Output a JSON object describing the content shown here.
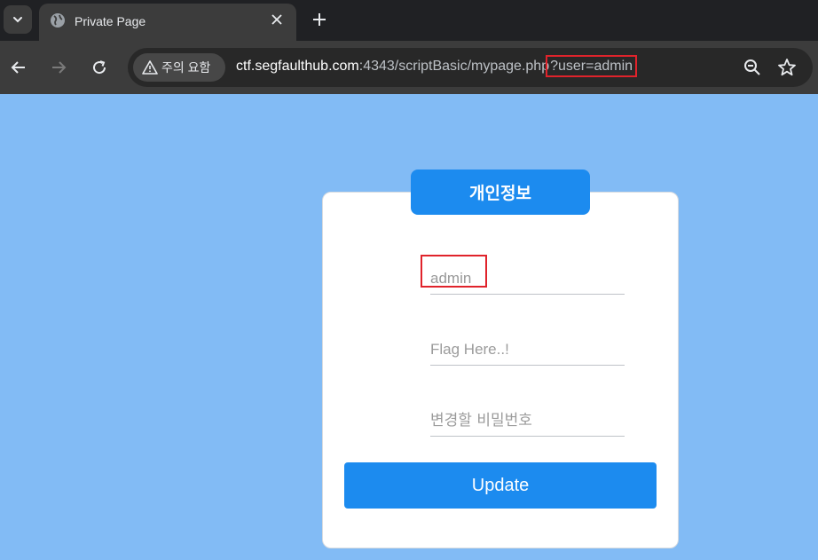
{
  "browser": {
    "tab": {
      "title": "Private Page"
    },
    "security_label": "주의 요함",
    "url": {
      "host": "ctf.segfaulthub.com",
      "rest": ":4343/scriptBasic/mypage.php",
      "query": "?user=admin"
    }
  },
  "page": {
    "badge": "개인정보",
    "fields": {
      "user_value": "admin",
      "flag_placeholder": "Flag Here..!",
      "password_placeholder": "변경할 비밀번호"
    },
    "update_label": "Update"
  },
  "colors": {
    "page_bg": "#82bbf5",
    "accent": "#1c8bef",
    "highlight": "#e0232b"
  }
}
